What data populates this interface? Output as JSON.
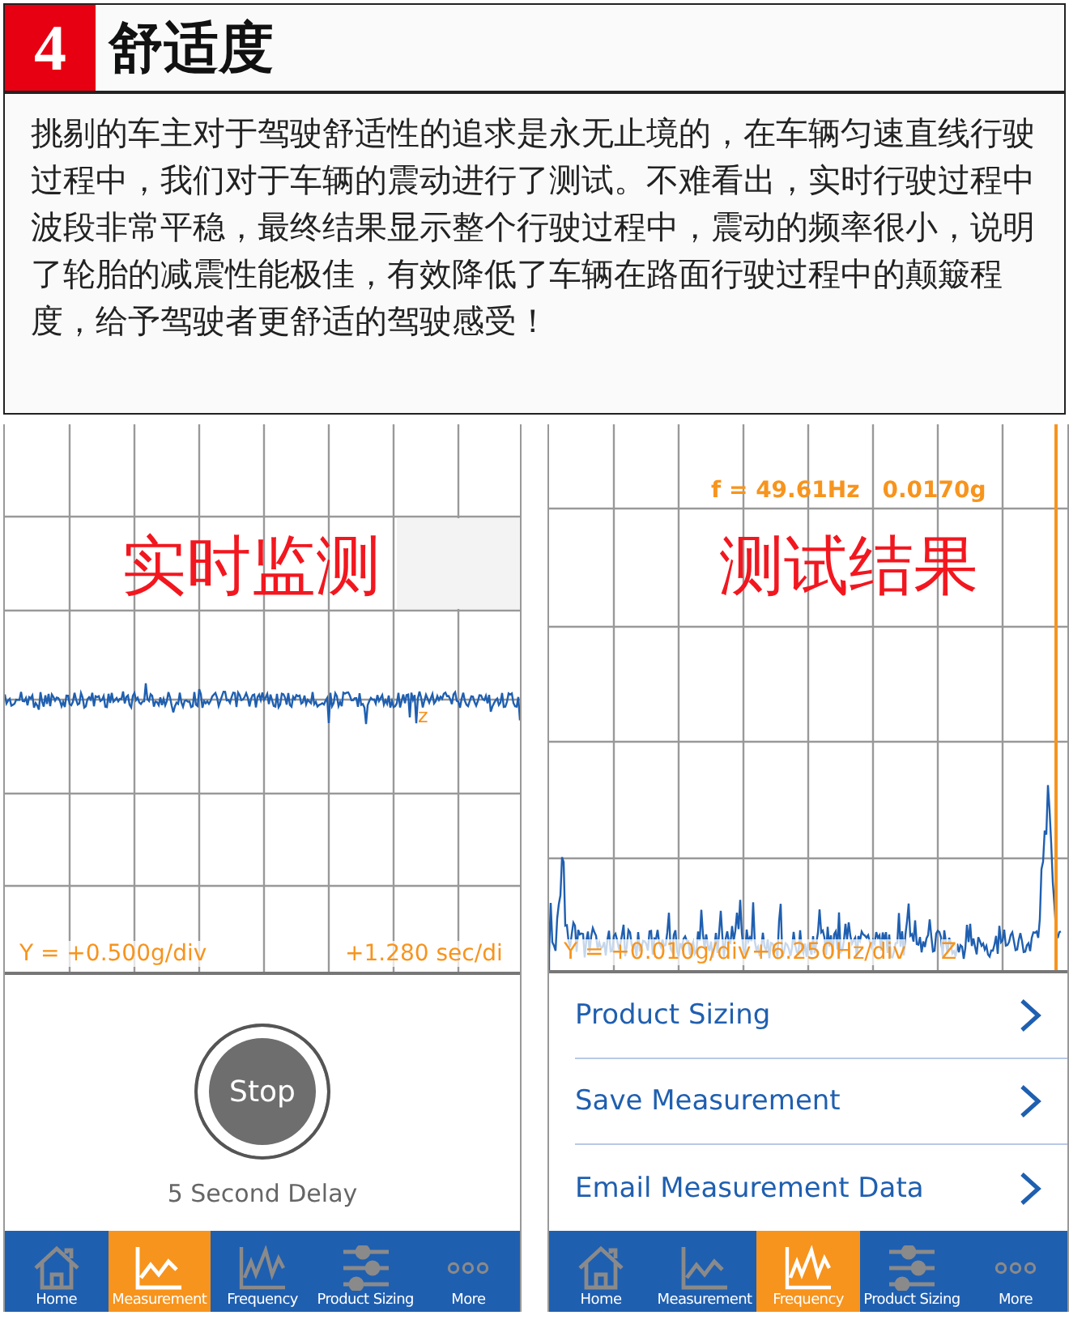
{
  "section": {
    "number": "4",
    "title": "舒适度"
  },
  "paragraph": "挑剔的车主对于驾驶舒适性的追求是永无止境的，在车辆匀速直线行驶过程中，我们对于车辆的震动进行了测试。不难看出，实时行驶过程中波段非常平稳，最终结果显示整个行驶过程中，震动的频率很小，说明了轮胎的减震性能极佳，有效降低了车辆在路面行驶过程中的颠簸程度，给予驾驶者更舒适的驾驶感受！",
  "phones": [
    {
      "kind": "live",
      "overlay_title": "实时监测",
      "axis_marker": "z",
      "scale_y": "Y = +0.500g/div",
      "scale_x": "+1.280 sec/di",
      "stop_button": "Stop",
      "delay": "5 Second Delay",
      "tabs": [
        {
          "kind": "home",
          "label": "Home",
          "selected": false
        },
        {
          "kind": "measurement",
          "label": "Measurement",
          "selected": true
        },
        {
          "kind": "frequency",
          "label": "Frequency",
          "selected": false
        },
        {
          "kind": "sizing",
          "label": "Product Sizing",
          "selected": false
        },
        {
          "kind": "more",
          "label": "More",
          "selected": false
        }
      ]
    },
    {
      "kind": "result",
      "overlay_title": "测试结果",
      "readout_freq": "f = 49.61Hz",
      "readout_amp": "0.0170g",
      "axis_marker": "Z",
      "scale_y": "Y = +0.010g/div",
      "scale_x": "+6.250Hz/div",
      "menu": [
        "Product Sizing",
        "Save Measurement",
        "Email Measurement Data"
      ],
      "tabs": [
        {
          "kind": "home",
          "label": "Home",
          "selected": false
        },
        {
          "kind": "measurement",
          "label": "Measurement",
          "selected": false
        },
        {
          "kind": "frequency",
          "label": "Frequency",
          "selected": true
        },
        {
          "kind": "sizing",
          "label": "Product Sizing",
          "selected": false
        },
        {
          "kind": "more",
          "label": "More",
          "selected": false
        }
      ]
    }
  ]
}
